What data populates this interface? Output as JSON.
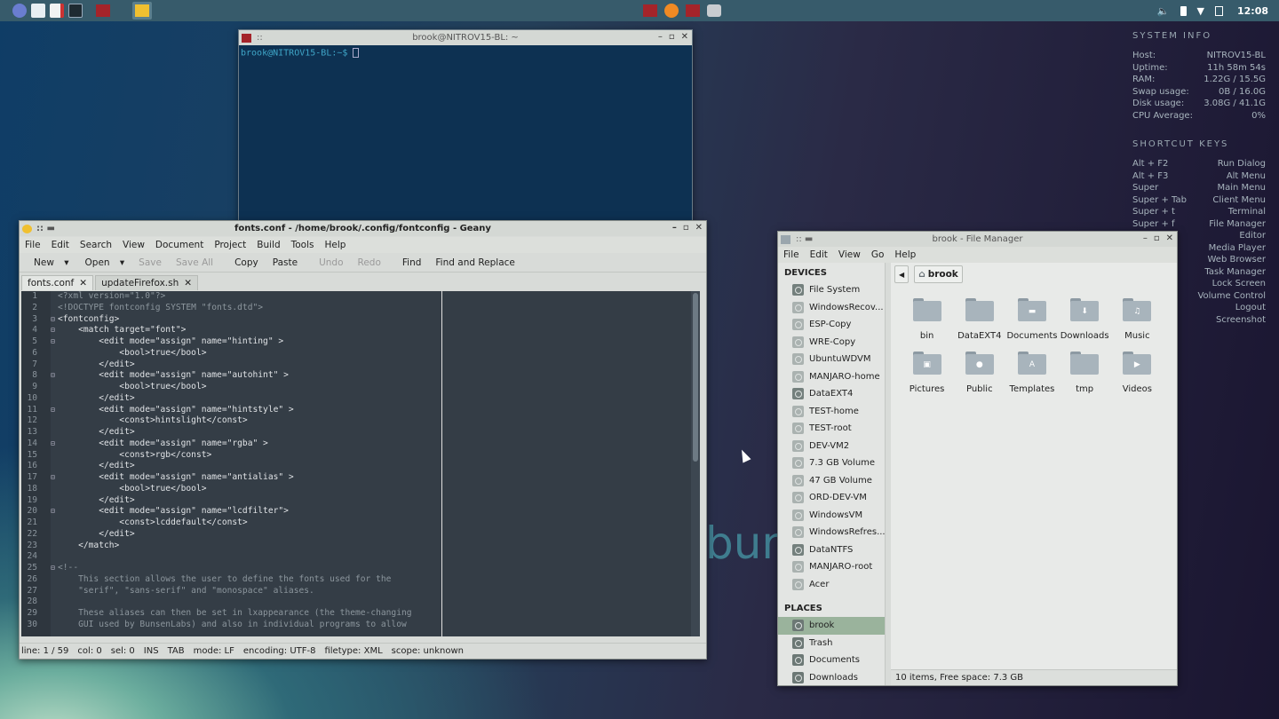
{
  "panel": {
    "clock": "12:08",
    "icons": [
      "launcher-icon",
      "folder-icon",
      "text-editor-icon",
      "terminal-icon",
      "geany-icon",
      "file-manager-icon"
    ],
    "tray_icons": [
      "volume-icon",
      "battery-icon",
      "wifi-icon",
      "clipboard-icon"
    ]
  },
  "conky": {
    "system_title": "SYSTEM INFO",
    "system": [
      {
        "label": "Host:",
        "value": "NITROV15-BL"
      },
      {
        "label": "Uptime:",
        "value": "11h 58m 54s"
      },
      {
        "label": "RAM:",
        "value": "1.22G / 15.5G"
      },
      {
        "label": "Swap usage:",
        "value": "0B / 16.0G"
      },
      {
        "label": "Disk usage:",
        "value": "3.08G / 41.1G"
      },
      {
        "label": "CPU Average:",
        "value": "0%"
      }
    ],
    "shortcut_title": "SHORTCUT KEYS",
    "shortcuts": [
      {
        "key": "Alt + F2",
        "action": "Run Dialog"
      },
      {
        "key": "Alt + F3",
        "action": "Alt Menu"
      },
      {
        "key": "Super",
        "action": "Main Menu"
      },
      {
        "key": "Super + Tab",
        "action": "Client Menu"
      },
      {
        "key": "Super + t",
        "action": "Terminal"
      },
      {
        "key": "Super + f",
        "action": "File Manager"
      },
      {
        "key": "",
        "action": "Editor"
      },
      {
        "key": "",
        "action": "Media Player"
      },
      {
        "key": "",
        "action": "Web Browser"
      },
      {
        "key": "",
        "action": "Task Manager"
      },
      {
        "key": "",
        "action": "Lock Screen"
      },
      {
        "key": "",
        "action": "Volume Control"
      },
      {
        "key": "",
        "action": "Logout"
      },
      {
        "key": "",
        "action": "Screenshot"
      }
    ]
  },
  "wallpaper_text": "bun",
  "terminal": {
    "title": "brook@NITROV15-BL: ~",
    "prompt": "brook@NITROV15-BL:~$"
  },
  "geany": {
    "title": "fonts.conf - /home/brook/.config/fontconfig - Geany",
    "menu": [
      "File",
      "Edit",
      "Search",
      "View",
      "Document",
      "Project",
      "Build",
      "Tools",
      "Help"
    ],
    "toolbar": {
      "new": "New",
      "open": "Open",
      "save": "Save",
      "save_all": "Save All",
      "copy": "Copy",
      "paste": "Paste",
      "undo": "Undo",
      "redo": "Redo",
      "find": "Find",
      "find_replace": "Find and Replace"
    },
    "tabs": [
      "fonts.conf",
      "updateFirefox.sh"
    ],
    "lines": [
      "<?xml version=\"1.0\"?>",
      "<!DOCTYPE fontconfig SYSTEM \"fonts.dtd\">",
      "<fontconfig>",
      "    <match target=\"font\">",
      "        <edit mode=\"assign\" name=\"hinting\" >",
      "            <bool>true</bool>",
      "        </edit>",
      "        <edit mode=\"assign\" name=\"autohint\" >",
      "            <bool>true</bool>",
      "        </edit>",
      "        <edit mode=\"assign\" name=\"hintstyle\" >",
      "            <const>hintslight</const>",
      "        </edit>",
      "        <edit mode=\"assign\" name=\"rgba\" >",
      "            <const>rgb</const>",
      "        </edit>",
      "        <edit mode=\"assign\" name=\"antialias\" >",
      "            <bool>true</bool>",
      "        </edit>",
      "        <edit mode=\"assign\" name=\"lcdfilter\">",
      "            <const>lcddefault</const>",
      "        </edit>",
      "    </match>",
      "",
      "<!--",
      "    This section allows the user to define the fonts used for the",
      "    \"serif\", \"sans-serif\" and \"monospace\" aliases.",
      "",
      "    These aliases can then be set in lxappearance (the theme-changing",
      "    GUI used by BunsenLabs) and also in individual programs to allow"
    ],
    "status": [
      "line: 1 / 59",
      "col: 0",
      "sel: 0",
      "INS",
      "TAB",
      "mode: LF",
      "encoding: UTF-8",
      "filetype: XML",
      "scope: unknown"
    ]
  },
  "fm": {
    "title": "brook - File Manager",
    "menu": [
      "File",
      "Edit",
      "View",
      "Go",
      "Help"
    ],
    "devices_header": "DEVICES",
    "devices": [
      "File System",
      "WindowsRecov...",
      "ESP-Copy",
      "WRE-Copy",
      "UbuntuWDVM",
      "MANJARO-home",
      "DataEXT4",
      "TEST-home",
      "TEST-root",
      "DEV-VM2",
      "7.3 GB Volume",
      "47 GB Volume",
      "ORD-DEV-VM",
      "WindowsVM",
      "WindowsRefres...",
      "DataNTFS",
      "MANJARO-root",
      "Acer"
    ],
    "places_header": "PLACES",
    "places": [
      "brook",
      "Trash",
      "Documents",
      "Downloads"
    ],
    "path": "brook",
    "items": [
      "bin",
      "DataEXT4",
      "Documents",
      "Downloads",
      "Music",
      "Pictures",
      "Public",
      "Templates",
      "tmp",
      "Videos"
    ],
    "status": "10 items, Free space: 7.3 GB"
  },
  "colors": {
    "panel": "#375b6b",
    "editor_bg": "#343d46",
    "terminal_bg": "#0d3152",
    "selected": "#9ab39c"
  }
}
